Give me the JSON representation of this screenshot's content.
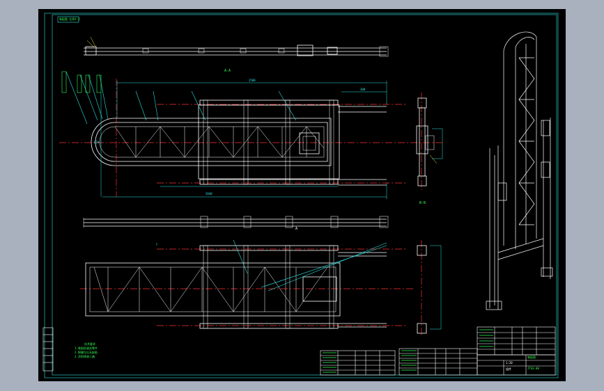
{
  "drawing": {
    "sheet_tag": "装配图 比例1:2",
    "section_a_label": "A-A",
    "section_b_label": "B-B",
    "view_letter": "A",
    "dim_top": "2500",
    "dim_bottom": "2040",
    "dim_right": "300",
    "dim_left": "820",
    "tech_requirements_title": "技术要求",
    "tech_requirements": [
      "1.装配前清洗零件",
      "2.焊缝均匀无缺陷",
      "3.涂防锈漆二遍"
    ],
    "title_block": {
      "drawing_no": "JTGX-00",
      "name": "装配图",
      "scale": "1:20",
      "material": "组件"
    },
    "colors": {
      "background": "#000000",
      "frame": "#2ee6e6",
      "geometry": "#ffffff",
      "centerline": "#ff3030",
      "dimension": "#2ee6e6",
      "text": "#33ff55"
    }
  }
}
